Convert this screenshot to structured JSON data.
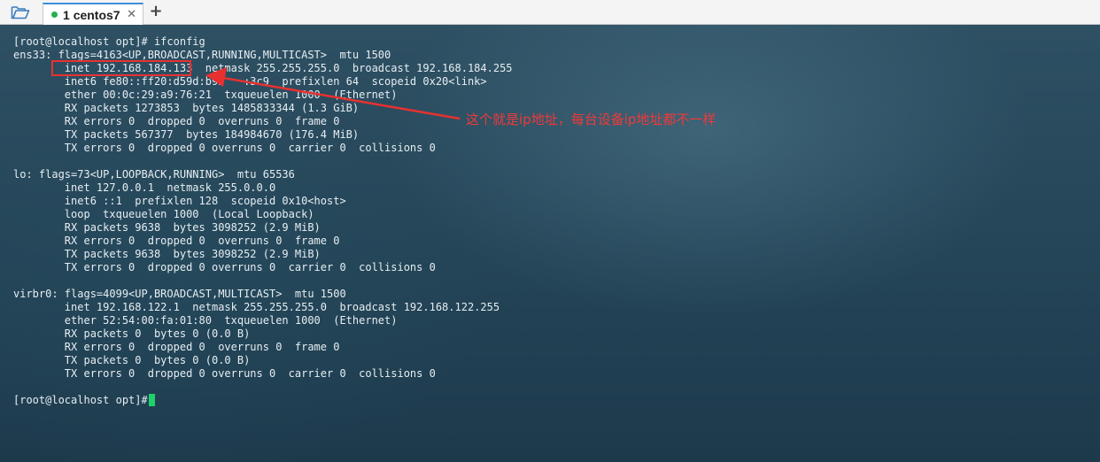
{
  "tabbar": {
    "tab_number": "1",
    "tab_title": "centos7",
    "close_glyph": "✕",
    "add_glyph": "+",
    "status_color": "#22b14c",
    "folder_icon": "folder-open-icon"
  },
  "terminal": {
    "lines": [
      "[root@localhost opt]# ifconfig",
      "ens33: flags=4163<UP,BROADCAST,RUNNING,MULTICAST>  mtu 1500",
      "        inet 192.168.184.133  netmask 255.255.255.0  broadcast 192.168.184.255",
      "        inet6 fe80::ff20:d59d:b95   :3c9  prefixlen 64  scopeid 0x20<link>",
      "        ether 00:0c:29:a9:76:21  txqueuelen 1000  (Ethernet)",
      "        RX packets 1273853  bytes 1485833344 (1.3 GiB)",
      "        RX errors 0  dropped 0  overruns 0  frame 0",
      "        TX packets 567377  bytes 184984670 (176.4 MiB)",
      "        TX errors 0  dropped 0 overruns 0  carrier 0  collisions 0",
      "",
      "lo: flags=73<UP,LOOPBACK,RUNNING>  mtu 65536",
      "        inet 127.0.0.1  netmask 255.0.0.0",
      "        inet6 ::1  prefixlen 128  scopeid 0x10<host>",
      "        loop  txqueuelen 1000  (Local Loopback)",
      "        RX packets 9638  bytes 3098252 (2.9 MiB)",
      "        RX errors 0  dropped 0  overruns 0  frame 0",
      "        TX packets 9638  bytes 3098252 (2.9 MiB)",
      "        TX errors 0  dropped 0 overruns 0  carrier 0  collisions 0",
      "",
      "virbr0: flags=4099<UP,BROADCAST,MULTICAST>  mtu 1500",
      "        inet 192.168.122.1  netmask 255.255.255.0  broadcast 192.168.122.255",
      "        ether 52:54:00:fa:01:80  txqueuelen 1000  (Ethernet)",
      "        RX packets 0  bytes 0 (0.0 B)",
      "        RX errors 0  dropped 0  overruns 0  frame 0",
      "        TX packets 0  bytes 0 (0.0 B)",
      "        TX errors 0  dropped 0 overruns 0  carrier 0  collisions 0",
      "",
      "[root@localhost opt]# "
    ],
    "cursor_color": "#1fd16a"
  },
  "annotation": {
    "text": "这个就是ip地址，每台设备ip地址都不一样",
    "color": "#ee3a3a"
  }
}
